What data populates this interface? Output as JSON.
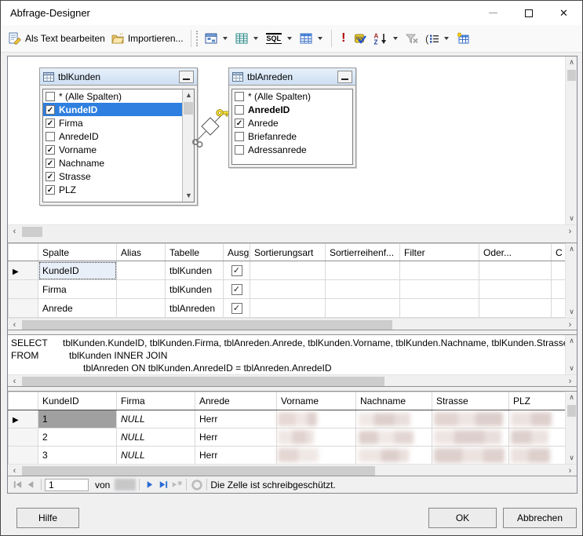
{
  "colors": {
    "selection_blue": "#2e7fe0",
    "nav_enabled_blue": "#2b6cd4",
    "table_title_bg": "#d6e4f4"
  },
  "window": {
    "title": "Abfrage-Designer"
  },
  "toolbar": {
    "edit_as_text_label": "Als Text bearbeiten",
    "import_label": "Importieren...",
    "icons": [
      "edit-as-text",
      "import",
      "diagram-pane",
      "grid-pane",
      "sql-pane",
      "results-pane",
      "execute",
      "verify-sql",
      "sort-ascending",
      "filter",
      "group-by",
      "add-table"
    ]
  },
  "diagram": {
    "tables": [
      {
        "name": "tblKunden",
        "fields": [
          {
            "label": "* (Alle Spalten)",
            "checked": false
          },
          {
            "label": "KundeID",
            "checked": true,
            "selected": true,
            "primary_key": true
          },
          {
            "label": "Firma",
            "checked": true
          },
          {
            "label": "AnredeID",
            "checked": false
          },
          {
            "label": "Vorname",
            "checked": true
          },
          {
            "label": "Nachname",
            "checked": true
          },
          {
            "label": "Strasse",
            "checked": true
          },
          {
            "label": "PLZ",
            "checked": true
          }
        ]
      },
      {
        "name": "tblAnreden",
        "fields": [
          {
            "label": "* (Alle Spalten)",
            "checked": false
          },
          {
            "label": "AnredeID",
            "checked": false,
            "primary_key": true
          },
          {
            "label": "Anrede",
            "checked": true
          },
          {
            "label": "Briefanrede",
            "checked": false
          },
          {
            "label": "Adressanrede",
            "checked": false
          }
        ]
      }
    ],
    "join": {
      "type": "INNER JOIN"
    }
  },
  "criteria": {
    "columns": [
      "Spalte",
      "Alias",
      "Tabelle",
      "Ausg...",
      "Sortierungsart",
      "Sortierreihenf...",
      "Filter",
      "Oder...",
      "C"
    ],
    "rows": [
      {
        "spalte": "KundeID",
        "alias": "",
        "tabelle": "tblKunden",
        "ausgabe": true
      },
      {
        "spalte": "Firma",
        "alias": "",
        "tabelle": "tblKunden",
        "ausgabe": true
      },
      {
        "spalte": "Anrede",
        "alias": "",
        "tabelle": "tblAnreden",
        "ausgabe": true
      }
    ]
  },
  "sql": {
    "select_keyword": "SELECT",
    "select_list": "tblKunden.KundeID, tblKunden.Firma, tblAnreden.Anrede, tblKunden.Vorname, tblKunden.Nachname, tblKunden.Strasse, t",
    "from_keyword": "FROM",
    "from_clause": "tblKunden INNER JOIN",
    "join_clause": "tblAnreden ON tblKunden.AnredeID = tblAnreden.AnredeID"
  },
  "results": {
    "columns": [
      "KundeID",
      "Firma",
      "Anrede",
      "Vorname",
      "Nachname",
      "Strasse",
      "PLZ"
    ],
    "rows": [
      {
        "kundeid": "1",
        "firma": "NULL",
        "anrede": "Herr"
      },
      {
        "kundeid": "2",
        "firma": "NULL",
        "anrede": "Herr"
      },
      {
        "kundeid": "3",
        "firma": "NULL",
        "anrede": "Herr"
      }
    ]
  },
  "navigator": {
    "position": "1",
    "of_label": "von",
    "status": "Die Zelle ist schreibgeschützt."
  },
  "footer": {
    "help_label": "Hilfe",
    "ok_label": "OK",
    "cancel_label": "Abbrechen"
  }
}
